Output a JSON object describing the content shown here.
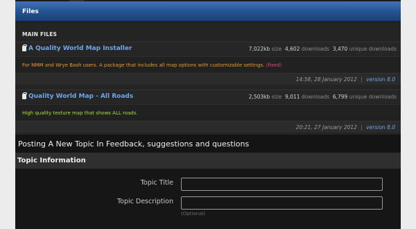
{
  "header": {
    "title": "Files"
  },
  "main_files": {
    "section_title": "MAIN FILES",
    "files": [
      {
        "name": "A Quality World Map Installer",
        "size_value": "7,022kb",
        "size_label": "size",
        "downloads_value": "4,602",
        "downloads_label": "downloads",
        "unique_value": "3,470",
        "unique_label": "unique downloads",
        "description": "For NMM and Wrye Bash users. A package that includes all map options with customizable settings.",
        "tag": "(fixed)",
        "date": "14:58, 28 January 2012",
        "separator": "|",
        "version": "version 8.0"
      },
      {
        "name": "Quality World Map - All Roads",
        "size_value": "2,503kb",
        "size_label": "size",
        "downloads_value": "9,011",
        "downloads_label": "downloads",
        "unique_value": "6,799",
        "unique_label": "unique downloads",
        "description": "High quality texture map that shows ALL roads.",
        "tag": "",
        "date": "20:21, 27 January 2012",
        "separator": "|",
        "version": "version 8.0"
      }
    ]
  },
  "posting": {
    "title": "Posting A New Topic In Feedback, suggestions and questions"
  },
  "topic_info": {
    "title": "Topic Information",
    "topic_title_label": "Topic Title",
    "topic_title_value": "",
    "topic_description_label": "Topic Description",
    "topic_description_value": "",
    "optional_hint": "(Optional)"
  },
  "colors": {
    "header_blue": "#224f8c",
    "link_blue": "#6ea6ee",
    "desc_orange": "#e79a33",
    "desc_green": "#a6e03a",
    "fixed_pink": "#e04c7a"
  }
}
